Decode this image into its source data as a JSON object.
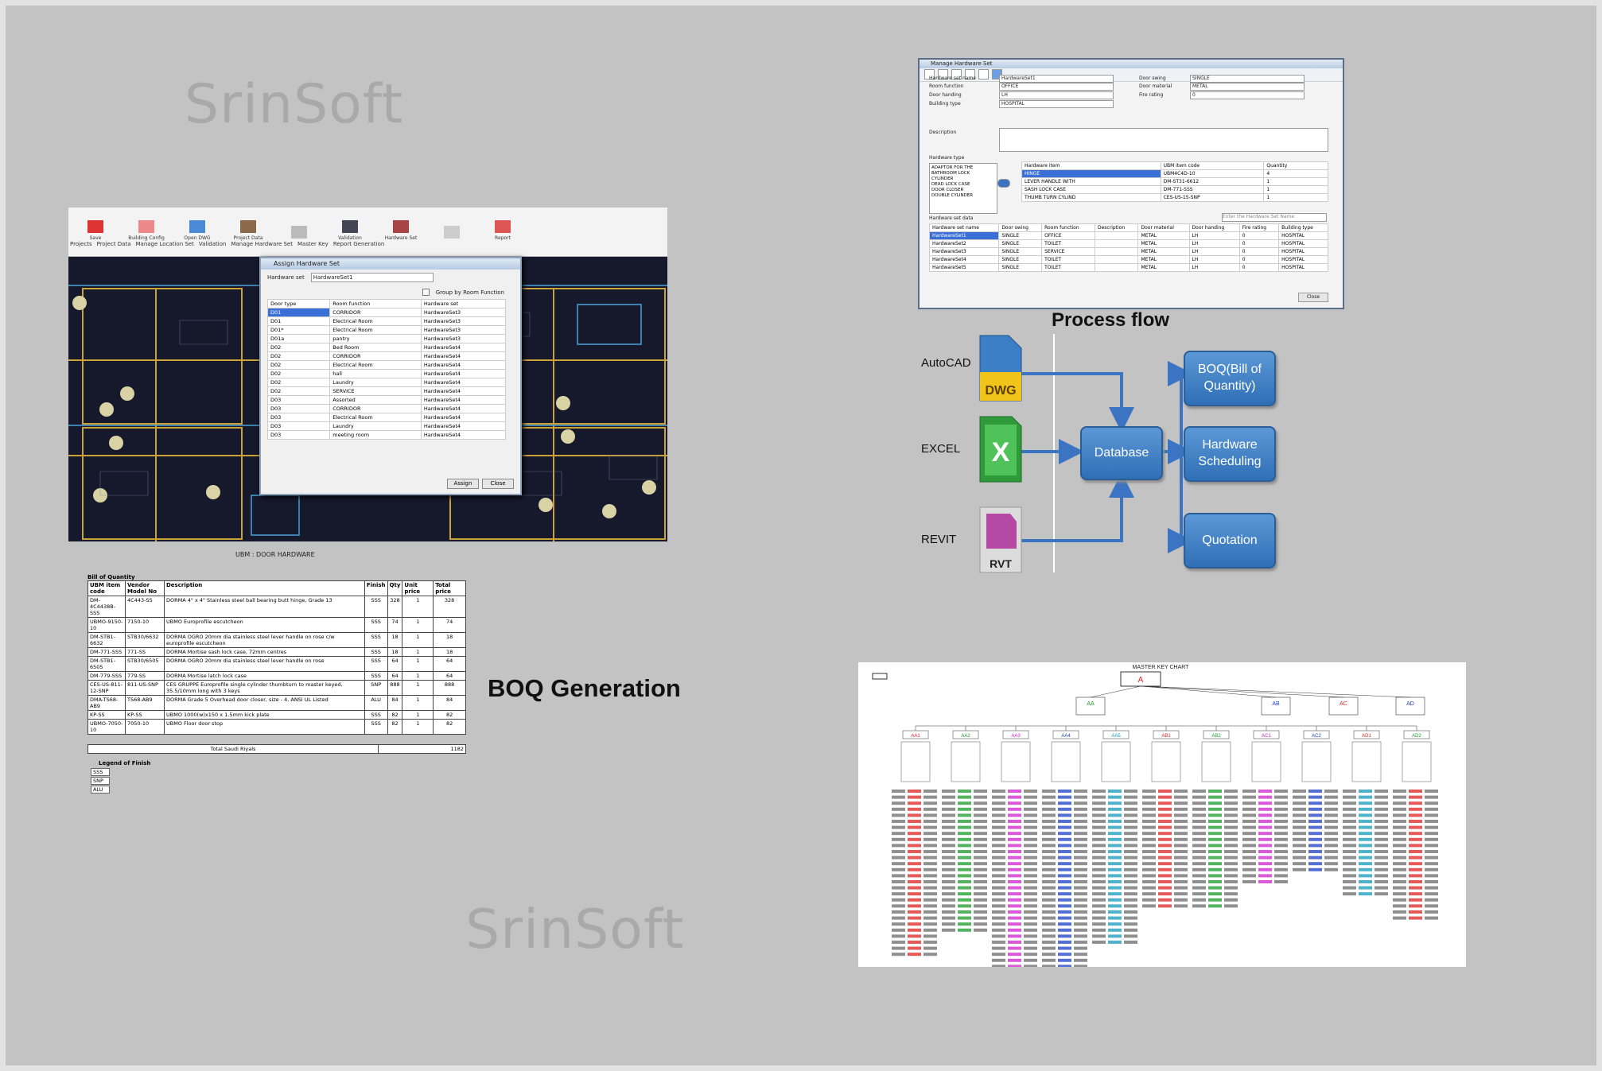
{
  "watermarks": [
    "SrinSoft",
    "SrinSoft"
  ],
  "headings": {
    "boq_generation": "BOQ Generation",
    "process_flow": "Process flow"
  },
  "process_flow": {
    "sources": [
      "AutoCAD",
      "EXCEL",
      "REVIT"
    ],
    "icon_labels": [
      "DWG",
      "X",
      "RVT"
    ],
    "hub": "Database",
    "outputs": [
      "BOQ(Bill of Quantity)",
      "Hardware Scheduling",
      "Quotation"
    ],
    "colors": {
      "box": "#3b7cc4",
      "arrow": "#3a74c2"
    }
  },
  "cad_panel": {
    "ribbon_tools": [
      "Save",
      "Building Config",
      "Open DWG",
      "Project Data",
      "",
      "Validation",
      "Hardware Set",
      "",
      "Report"
    ],
    "ribbon_groups": [
      "Projects",
      "Project Data",
      "Manage Location Set",
      "Validation",
      "Manage Hardware Set",
      "Master Key",
      "Report Generation"
    ],
    "dialog_title": "Assign Hardware Set",
    "hardware_set_label": "Hardware set",
    "hardware_set_value": "HardwareSet1",
    "group_by_label": "Group by Room Function",
    "columns": [
      "Door type",
      "Room function",
      "Hardware set"
    ],
    "rows": [
      [
        "D01",
        "CORRIDOR",
        "HardwareSet3"
      ],
      [
        "D01",
        "Electrical Room",
        "HardwareSet3"
      ],
      [
        "D01*",
        "Electrical Room",
        "HardwareSet3"
      ],
      [
        "D01a",
        "pantry",
        "HardwareSet3"
      ],
      [
        "D02",
        "Bed Room",
        "HardwareSet4"
      ],
      [
        "D02",
        "CORRIDOR",
        "HardwareSet4"
      ],
      [
        "D02",
        "Electrical Room",
        "HardwareSet4"
      ],
      [
        "D02",
        "hall",
        "HardwareSet4"
      ],
      [
        "D02",
        "Laundry",
        "HardwareSet4"
      ],
      [
        "D02",
        "SERVICE",
        "HardwareSet4"
      ],
      [
        "D03",
        "Assorted",
        "HardwareSet4"
      ],
      [
        "D03",
        "CORRIDOR",
        "HardwareSet4"
      ],
      [
        "D03",
        "Electrical Room",
        "HardwareSet4"
      ],
      [
        "D03",
        "Laundry",
        "HardwareSet4"
      ],
      [
        "D03",
        "meeting room",
        "HardwareSet4"
      ]
    ],
    "buttons": [
      "Assign",
      "Close"
    ],
    "caption": "UBM : DOOR HARDWARE"
  },
  "boq": {
    "title": "Bill of Quantity",
    "columns": [
      "UBM item code",
      "Vendor Model No",
      "Description",
      "Finish",
      "Qty",
      "Unit price",
      "Total price"
    ],
    "rows": [
      [
        "DM-4C4438B-SSS",
        "4C443-SS",
        "DORMA 4\" x 4\" Stainless steel ball bearing butt hinge, Grade 13",
        "SSS",
        "328",
        "1",
        "328"
      ],
      [
        "UBMO-9150-10",
        "7150-10",
        "UBMO Europrofile escutcheon",
        "SSS",
        "74",
        "1",
        "74"
      ],
      [
        "DM-STB1-6632",
        "STB30/6632",
        "DORMA OGRO 20mm dia stainless steel lever handle on rose c/w europrofile escutcheon",
        "SSS",
        "18",
        "1",
        "18"
      ],
      [
        "DM-771-SSS",
        "771-SS",
        "DORMA Mortise sash lock case, 72mm centres",
        "SSS",
        "18",
        "1",
        "18"
      ],
      [
        "DM-STB1-6505",
        "STB30/6505",
        "DORMA OGRO 20mm dia stainless steel lever handle on rose",
        "SSS",
        "64",
        "1",
        "64"
      ],
      [
        "DM-779-SSS",
        "779-SS",
        "DORMA Mortise latch lock case",
        "SSS",
        "64",
        "1",
        "64"
      ],
      [
        "CES-US-811-12-SNP",
        "811-US-SNP",
        "CES GRUPPE Europrofile single cylinder thumbturn to master keyed, 35.5/10mm long with 3 keys",
        "SNP",
        "888",
        "1",
        "888"
      ],
      [
        "DMA-TS68-AB9",
        "TS68-AB9",
        "DORMA Grade 5 Overhead door closer, size - 4, ANSI UL Listed",
        "ALU",
        "84",
        "1",
        "84"
      ],
      [
        "KP-SS",
        "KP-SS",
        "UBMO 1000(w)x150 x 1.5mm kick plate",
        "SSS",
        "82",
        "1",
        "82"
      ],
      [
        "UBMO-7050-10",
        "7050-10",
        "UBMO Floor door stop",
        "SSS",
        "82",
        "1",
        "82"
      ]
    ],
    "total_label": "Total Saudi Riyals",
    "total_value": "1182",
    "legend_title": "Legend of Finish",
    "legend_items": [
      "SSS",
      "SNP",
      "ALU"
    ]
  },
  "hardware_dialog": {
    "title": "Manage Hardware Set",
    "fields_left": [
      {
        "label": "Hardware set name",
        "value": "HardwareSet1"
      },
      {
        "label": "Room function",
        "value": "OFFICE"
      },
      {
        "label": "Door handing",
        "value": "LH"
      },
      {
        "label": "Building type",
        "value": "HOSPITAL"
      }
    ],
    "fields_right": [
      {
        "label": "Door swing",
        "value": "SINGLE"
      },
      {
        "label": "Door material",
        "value": "METAL"
      },
      {
        "label": "Fire rating",
        "value": "0"
      }
    ],
    "description_label": "Description",
    "hardware_type_label": "Hardware type",
    "hardware_types": [
      "ADAPTOR FOR THE",
      "BATHROOM LOCK",
      "CYLINDER",
      "DEAD LOCK CASE",
      "DOOR CLOSER",
      "DOUBLE CYLINDER"
    ],
    "item_columns": [
      "Hardware item",
      "UBM item code",
      "Quantity"
    ],
    "items": [
      [
        "HINGE",
        "UBM4C4D-10",
        "4"
      ],
      [
        "LEVER HANDLE WITH",
        "DM-ST31-6612",
        "1"
      ],
      [
        "SASH LOCK CASE",
        "DM-771-SSS",
        "1"
      ],
      [
        "THUMB TURN CYLIND",
        "CES-US-15-SNP",
        "1"
      ]
    ],
    "set_data_label": "Hardware set data",
    "filter_placeholder": "Enter the Hardware Set Name",
    "set_columns": [
      "Hardware set name",
      "Door swing",
      "Room function",
      "Description",
      "Door material",
      "Door handing",
      "Fire rating",
      "Building type"
    ],
    "sets": [
      [
        "HardwareSet1",
        "SINGLE",
        "OFFICE",
        "",
        "METAL",
        "LH",
        "0",
        "HOSPITAL"
      ],
      [
        "HardwareSet2",
        "SINGLE",
        "TOILET",
        "",
        "METAL",
        "LH",
        "0",
        "HOSPITAL"
      ],
      [
        "HardwareSet3",
        "SINGLE",
        "SERVICE",
        "",
        "METAL",
        "LH",
        "0",
        "HOSPITAL"
      ],
      [
        "HardwareSet4",
        "SINGLE",
        "TOILET",
        "",
        "METAL",
        "LH",
        "0",
        "HOSPITAL"
      ],
      [
        "HardwareSet5",
        "SINGLE",
        "TOILET",
        "",
        "METAL",
        "LH",
        "0",
        "HOSPITAL"
      ]
    ],
    "close_label": "Close"
  },
  "master_key_chart": {
    "title": "MASTER KEY CHART",
    "root": "A",
    "level2": [
      "AA",
      "AB",
      "AC",
      "AD"
    ],
    "level3": [
      "AA1",
      "AA2",
      "AA3",
      "AA4",
      "AA5",
      "AB1",
      "AB2",
      "AC1",
      "AC2",
      "AD1",
      "AD2"
    ]
  }
}
